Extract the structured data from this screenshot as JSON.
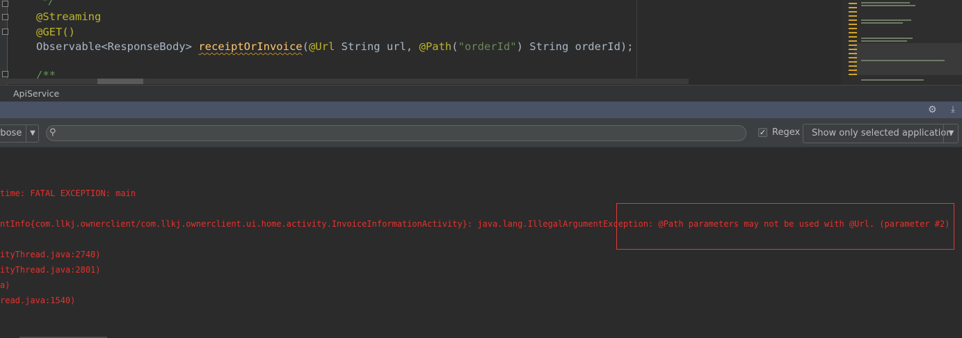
{
  "editor": {
    "lines": {
      "comment_end": "*/",
      "annotation_streaming": "@Streaming",
      "annotation_get": "@GET()",
      "method_type": "Observable<ResponseBody> ",
      "method_name": "receiptOrInvoice",
      "paren_open": "(",
      "annot_url": "@Url",
      "param_url": " String url, ",
      "annot_path": "@Path",
      "path_open": "(",
      "path_value": "\"orderId\"",
      "path_rest": ") String orderId);",
      "comment_start": "/**"
    }
  },
  "breadcrumb": {
    "file": "ApiService"
  },
  "toolbar": {
    "log_level": "rbose",
    "search_placeholder": "",
    "search_value": "",
    "regex_label": "Regex",
    "regex_checked": "✓",
    "filter_label": "Show only selected application",
    "dropdown_arrow": "▼"
  },
  "icons": {
    "search": "search-icon",
    "gear": "gear-icon",
    "hide": "hide-icon",
    "search_glyph": "⚲",
    "gear_glyph": "⚙",
    "hide_glyph": "⤓"
  },
  "log": {
    "lines": [
      "time: FATAL EXCEPTION: main",
      "ntInfo{com.llkj.ownerclient/com.llkj.ownerclient.ui.home.activity.InvoiceInformationActivity}: java.lang.IllegalArgumentException: @Path parameters may not be used with @Url. (parameter #2)",
      "ityThread.java:2740)",
      "ityThread.java:2801)",
      "a)",
      "read.java:1540)"
    ]
  },
  "colors": {
    "editor_bg": "#2b2b2b",
    "annotation": "#bbb529",
    "string": "#6a8759",
    "method": "#ffc66d",
    "default_code": "#a9b7c6",
    "log_error": "#e8312c",
    "tool_header": "#4a5265",
    "highlight_box": "#e03a35"
  }
}
